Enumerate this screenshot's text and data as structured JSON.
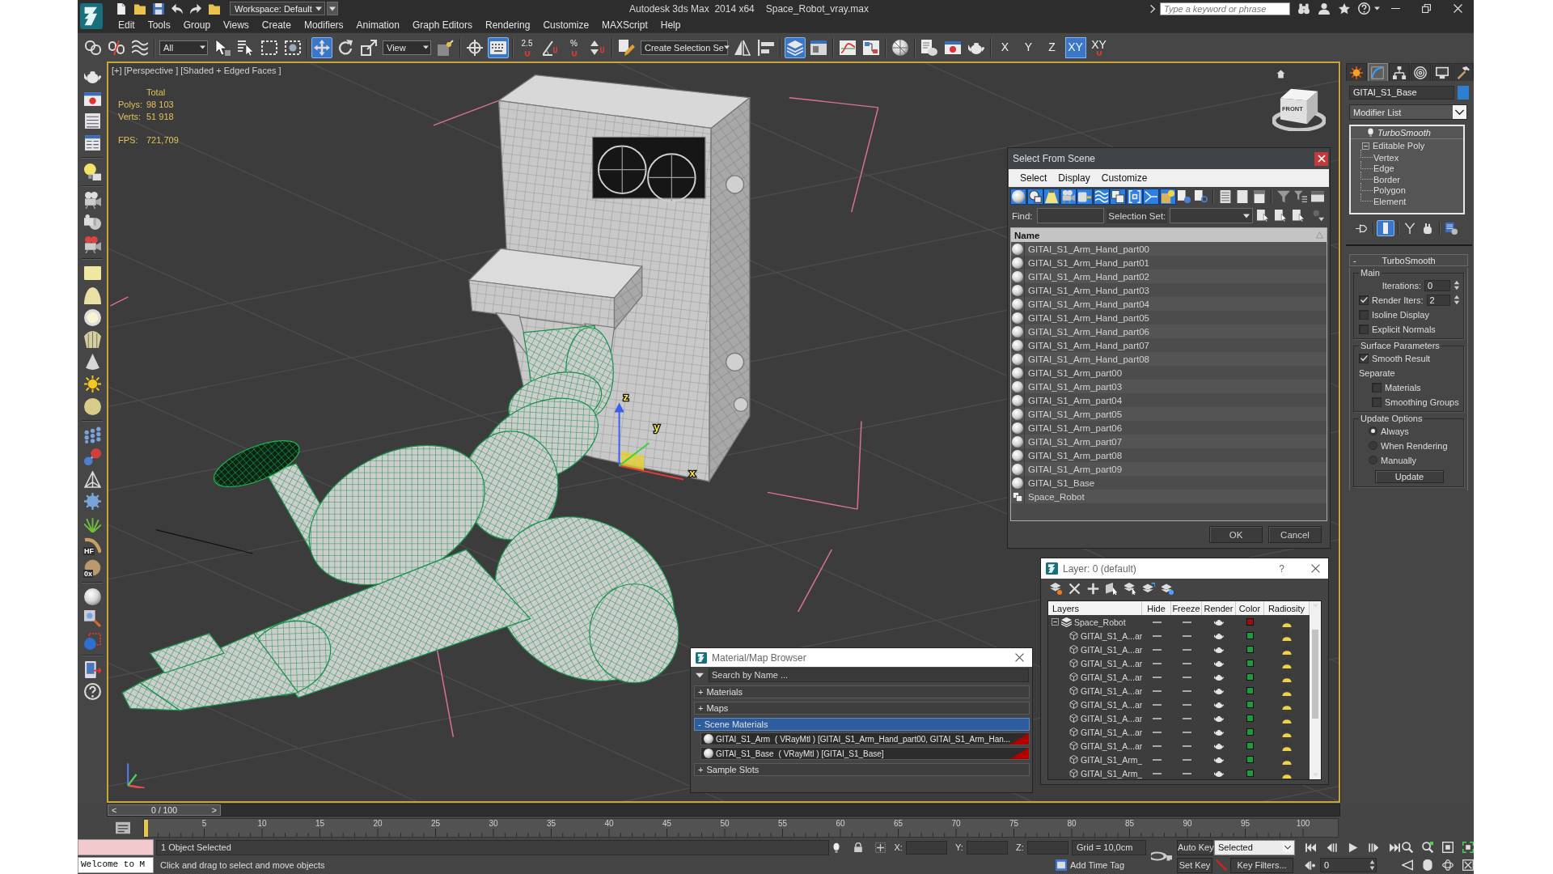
{
  "window": {
    "workspace": "Workspace: Default",
    "app_title": "Autodesk 3ds Max  2014 x64",
    "file_name": "Space_Robot_vray.max",
    "search": {
      "placeholder": "Type a keyword or phrase"
    }
  },
  "menu": [
    "Edit",
    "Tools",
    "Group",
    "Views",
    "Create",
    "Modifiers",
    "Animation",
    "Graph Editors",
    "Rendering",
    "Customize",
    "MAXScript",
    "Help"
  ],
  "main_toolbar": {
    "selection_filter": "All",
    "reference_coordinates": "View",
    "named_selection": "Create Selection Se",
    "snaps": [
      {
        "label": "2.5"
      },
      {
        "label": "%"
      }
    ],
    "toggles": [
      {
        "selected": true
      },
      {
        "selected": false
      },
      {
        "selected": false
      },
      {
        "selected": true
      },
      {
        "selected": true
      }
    ],
    "constraints": [
      {
        "label": "X",
        "selected": false,
        "kind": "axis"
      },
      {
        "label": "Y",
        "selected": false,
        "kind": "axis"
      },
      {
        "label": "Z",
        "selected": false,
        "kind": "axis"
      },
      {
        "label": "XY",
        "selected": true,
        "kind": "axis"
      },
      {
        "label": "XY",
        "selected": false,
        "kind": "snap"
      }
    ]
  },
  "left_toolbar": {
    "badges": [
      "HF",
      "0x"
    ]
  },
  "viewport": {
    "active": true,
    "labels": [
      "[+]",
      "[Perspective ]",
      "[Shaded + Edged Faces ]"
    ],
    "stats": {
      "header": "Total",
      "rows": [
        {
          "label": "Polys:",
          "value": "98 103",
          "kind": "count"
        },
        {
          "label": "Verts:",
          "value": "51 918",
          "kind": "count"
        },
        {
          "label": "FPS:",
          "value": "721,709",
          "kind": "fps"
        }
      ]
    },
    "view_cube_label": "FRONT",
    "gizmo_axes": [
      "z",
      "y",
      "x"
    ]
  },
  "select_from_scene": {
    "title": "Select From Scene",
    "menu": [
      "Select",
      "Display",
      "Customize"
    ],
    "filters": [
      {
        "on": true
      },
      {
        "on": true
      },
      {
        "on": true
      },
      {
        "on": true
      },
      {
        "on": true
      },
      {
        "on": true
      },
      {
        "on": true
      },
      {
        "on": true
      },
      {
        "on": true
      },
      {
        "on": true
      },
      {
        "on": false
      },
      {
        "on": false
      }
    ],
    "find_label": "Find:",
    "selection_set_label": "Selection Set:",
    "column": "Name",
    "objects": [
      {
        "name": "GITAI_S1_Arm_Hand_part00",
        "kind": "geometry",
        "selected": false
      },
      {
        "name": "GITAI_S1_Arm_Hand_part01",
        "kind": "geometry",
        "selected": false
      },
      {
        "name": "GITAI_S1_Arm_Hand_part02",
        "kind": "geometry",
        "selected": false
      },
      {
        "name": "GITAI_S1_Arm_Hand_part03",
        "kind": "geometry",
        "selected": false
      },
      {
        "name": "GITAI_S1_Arm_Hand_part04",
        "kind": "geometry",
        "selected": false
      },
      {
        "name": "GITAI_S1_Arm_Hand_part05",
        "kind": "geometry",
        "selected": false
      },
      {
        "name": "GITAI_S1_Arm_Hand_part06",
        "kind": "geometry",
        "selected": false
      },
      {
        "name": "GITAI_S1_Arm_Hand_part07",
        "kind": "geometry",
        "selected": false
      },
      {
        "name": "GITAI_S1_Arm_Hand_part08",
        "kind": "geometry",
        "selected": false
      },
      {
        "name": "GITAI_S1_Arm_part00",
        "kind": "geometry",
        "selected": false
      },
      {
        "name": "GITAI_S1_Arm_part03",
        "kind": "geometry",
        "selected": false
      },
      {
        "name": "GITAI_S1_Arm_part04",
        "kind": "geometry",
        "selected": false
      },
      {
        "name": "GITAI_S1_Arm_part05",
        "kind": "geometry",
        "selected": false
      },
      {
        "name": "GITAI_S1_Arm_part06",
        "kind": "geometry",
        "selected": false
      },
      {
        "name": "GITAI_S1_Arm_part07",
        "kind": "geometry",
        "selected": false
      },
      {
        "name": "GITAI_S1_Arm_part08",
        "kind": "geometry",
        "selected": false
      },
      {
        "name": "GITAI_S1_Arm_part09",
        "kind": "geometry",
        "selected": false
      },
      {
        "name": "GITAI_S1_Base",
        "kind": "geometry",
        "selected": false
      },
      {
        "name": "Space_Robot",
        "kind": "group",
        "selected": false
      }
    ],
    "buttons": [
      "OK",
      "Cancel"
    ]
  },
  "command_panel": {
    "tabs": [
      {
        "selected": false
      },
      {
        "selected": true
      },
      {
        "selected": false
      },
      {
        "selected": false
      },
      {
        "selected": false
      },
      {
        "selected": false
      }
    ],
    "object_name": "GITAI_S1_Base",
    "modifier_list": "Modifier List",
    "show_end_result": true,
    "stack": [
      {
        "name": "TurboSmooth",
        "kind": "modifier",
        "on": true,
        "selected": false
      },
      {
        "name": "Editable Poly",
        "kind": "object",
        "expanded": true,
        "selected": false,
        "children": [
          {
            "name": "Vertex",
            "selected": false
          },
          {
            "name": "Edge",
            "selected": false
          },
          {
            "name": "Border",
            "selected": false
          },
          {
            "name": "Polygon",
            "selected": false
          },
          {
            "name": "Element",
            "selected": false
          }
        ]
      }
    ],
    "rollout": {
      "toggle": "-",
      "title": "TurboSmooth",
      "groups": [
        {
          "title": "Main",
          "controls": [
            {
              "kind": "spinner",
              "label": "Iterations:",
              "value": "0"
            },
            {
              "kind": "check_spinner",
              "label": "Render Iters:",
              "checked": true,
              "value": "2"
            },
            {
              "kind": "checkbox",
              "label": "Isoline Display",
              "checked": false
            },
            {
              "kind": "checkbox",
              "label": "Explicit Normals",
              "checked": false
            }
          ]
        },
        {
          "title": "Surface Parameters",
          "controls": [
            {
              "kind": "checkbox",
              "label": "Smooth Result",
              "checked": true
            },
            {
              "kind": "label",
              "label": "Separate",
              "children": [
                {
                  "kind": "checkbox",
                  "label": "Materials",
                  "checked": false
                },
                {
                  "kind": "checkbox",
                  "label": "Smoothing Groups",
                  "checked": false
                }
              ]
            }
          ]
        },
        {
          "title": "Update Options",
          "controls": [
            {
              "kind": "radio",
              "label": "Always",
              "selected": true
            },
            {
              "kind": "radio",
              "label": "When Rendering",
              "selected": false
            },
            {
              "kind": "radio",
              "label": "Manually",
              "selected": false
            },
            {
              "kind": "button",
              "label": "Update"
            }
          ]
        }
      ]
    }
  },
  "layer_dialog": {
    "title": "Layer: 0 (default)",
    "help": "?",
    "columns": [
      "Layers",
      "Hide",
      "Freeze",
      "Render",
      "Color",
      "Radiosity"
    ],
    "layers": [
      {
        "name": "Space_Robot",
        "color": "#a00f0f",
        "expanded": true,
        "children": [
          {
            "name": "GITAI_S1_A...ar",
            "color": "#1f9a3d"
          },
          {
            "name": "GITAI_S1_A...ar",
            "color": "#1f9a3d"
          },
          {
            "name": "GITAI_S1_A...ar",
            "color": "#1f9a3d"
          },
          {
            "name": "GITAI_S1_A...ar",
            "color": "#1f9a3d"
          },
          {
            "name": "GITAI_S1_A...ar",
            "color": "#1f9a3d"
          },
          {
            "name": "GITAI_S1_A...ar",
            "color": "#1f9a3d"
          },
          {
            "name": "GITAI_S1_A...ar",
            "color": "#1f9a3d"
          },
          {
            "name": "GITAI_S1_A...ar",
            "color": "#1f9a3d"
          },
          {
            "name": "GITAI_S1_A...ar",
            "color": "#1f9a3d"
          },
          {
            "name": "GITAI_S1_Arm_",
            "color": "#1f9a3d"
          },
          {
            "name": "GITAI_S1_Arm_",
            "color": "#1f9a3d"
          }
        ]
      }
    ]
  },
  "material_browser": {
    "title": "Material/Map Browser",
    "search": {
      "placeholder": "Search by Name ..."
    },
    "groups": [
      {
        "toggle": "+",
        "name": "Materials",
        "selected": false
      },
      {
        "toggle": "+",
        "name": "Maps",
        "selected": false
      },
      {
        "toggle": "-",
        "name": "Scene Materials",
        "selected": true,
        "items": [
          {
            "name": "GITAI_S1_Arm",
            "type": "( VRayMtl )",
            "objects": "[GITAI_S1_Arm_Hand_part00, GITAI_S1_Arm_Han..."
          },
          {
            "name": "GITAI_S1_Base",
            "type": "( VRayMtl )",
            "objects": "[GITAI_S1_Base]"
          }
        ]
      },
      {
        "toggle": "+",
        "name": "Sample Slots",
        "selected": false
      }
    ]
  },
  "time_slider": {
    "prev": "<",
    "position": "0 / 100",
    "next": ">",
    "level": 0
  },
  "track_bar": {
    "ticks": [
      "5",
      "10",
      "15",
      "20",
      "25",
      "30",
      "35",
      "40",
      "45",
      "50",
      "55",
      "60",
      "65",
      "70",
      "75",
      "80",
      "85",
      "90",
      "95",
      "100"
    ]
  },
  "status": {
    "listener_input": "Welcome to M",
    "selection": "1 Object Selected",
    "prompt": "Click and drag to select and move objects",
    "coordinates": [
      "X:",
      "Y:",
      "Z:"
    ],
    "grid": "Grid = 10,0cm",
    "add_time_tag": "Add Time Tag",
    "auto_key": "Auto Key",
    "key_mode": "Selected",
    "set_key": "Set Key",
    "key_filters": "Key Filters...",
    "frame": "0"
  }
}
